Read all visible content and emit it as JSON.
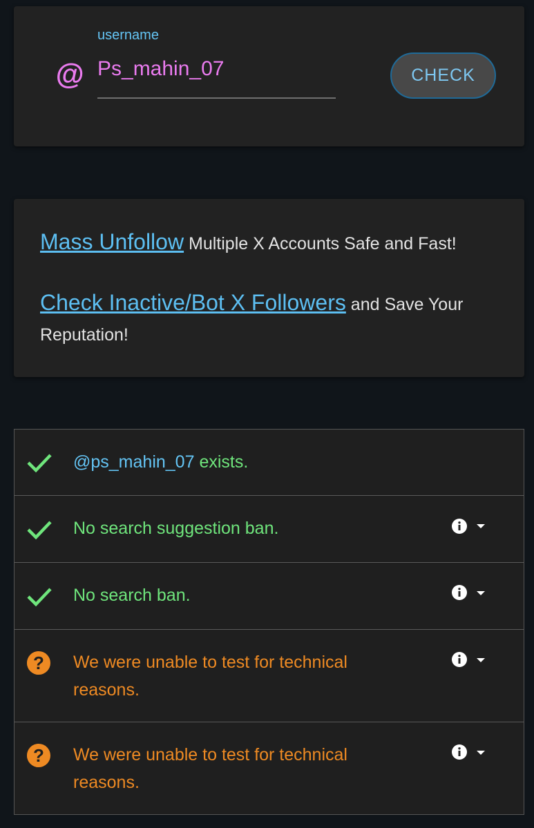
{
  "search": {
    "at_symbol": "@",
    "label": "username",
    "value": "Ps_mahin_07",
    "check_button": "CHECK"
  },
  "promo": {
    "line1_link": "Mass Unfollow",
    "line1_text": " Multiple X Accounts Safe and Fast!",
    "line2_link": "Check Inactive/Bot X Followers",
    "line2_text": " and Save Your Reputation!"
  },
  "results": [
    {
      "status": "ok",
      "handle": "@ps_mahin_07",
      "text": " exists.",
      "icon": "check-icon"
    },
    {
      "status": "ok",
      "text": "No search suggestion ban.",
      "icon": "check-icon",
      "has_info": true
    },
    {
      "status": "ok",
      "text": "No search ban.",
      "icon": "check-icon",
      "has_info": true
    },
    {
      "status": "unknown",
      "text": "We were unable to test for technical reasons.",
      "icon": "question-icon",
      "has_info": true
    },
    {
      "status": "unknown",
      "text": "We were unable to test for technical reasons.",
      "icon": "question-icon",
      "has_info": true
    }
  ],
  "colors": {
    "background": "#10151a",
    "card": "#222222",
    "accent_pink": "#ea7bef",
    "accent_blue": "#64c4f4",
    "ok_green": "#6fe57c",
    "warn_orange": "#ee8a23"
  }
}
